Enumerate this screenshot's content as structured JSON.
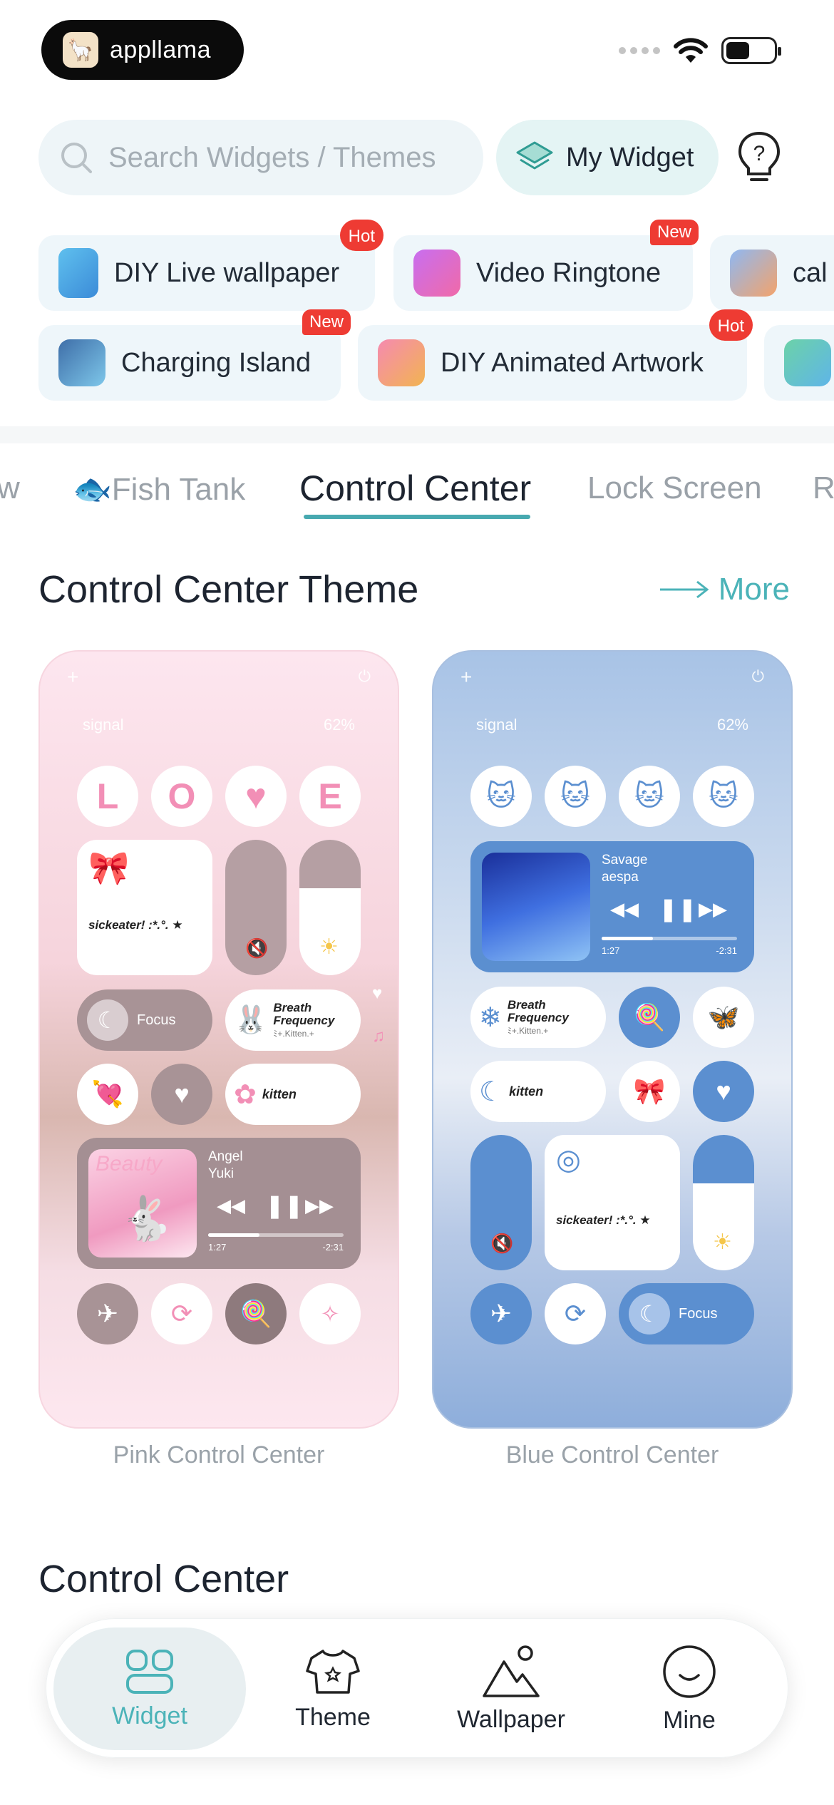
{
  "brand": {
    "name": "appllama",
    "logo_icon": "llama-logo-icon"
  },
  "status": {
    "wifi_icon": "wifi-icon",
    "battery_icon": "battery-icon"
  },
  "search": {
    "placeholder": "Search Widgets / Themes"
  },
  "my_widget": {
    "label": "My Widget"
  },
  "features": {
    "row1": [
      {
        "label": "DIY Live wallpaper",
        "badge": "Hot"
      },
      {
        "label": "Video Ringtone",
        "badge": "New"
      },
      {
        "label": "cal",
        "badge": ""
      }
    ],
    "row2": [
      {
        "label": "Charging Island",
        "badge": "New"
      },
      {
        "label": "DIY Animated Artwork",
        "badge": "Hot"
      }
    ]
  },
  "tabs": [
    "w",
    "🐟Fish Tank",
    "Control Center",
    "Lock Screen",
    "R"
  ],
  "active_tab": "Control Center",
  "section1": {
    "title": "Control Center Theme",
    "more": "More"
  },
  "cards": [
    {
      "caption": "Pink Control Center",
      "signal": "signal",
      "battery": "62%",
      "letters": [
        "L",
        "O",
        "E"
      ],
      "focus": "Focus",
      "breath": "Breath Frequency",
      "kitten_sub": "ﾐ+.Kitten.+",
      "kitten": "kitten",
      "quote": "sickeater! :*.°. ★",
      "music": {
        "title": "Angel",
        "artist": "Yuki",
        "elapsed": "1:27",
        "remaining": "-2:31",
        "art_text": "Beauty",
        "progress": 0.38
      }
    },
    {
      "caption": "Blue Control Center",
      "signal": "signal",
      "battery": "62%",
      "focus": "Focus",
      "breath": "Breath Frequency",
      "kitten_sub": "ﾐ+.Kitten.+",
      "kitten": "kitten",
      "quote": "sickeater! :*.°. ★",
      "music": {
        "title": "Savage",
        "artist": "aespa",
        "elapsed": "1:27",
        "remaining": "-2:31",
        "progress": 0.38
      }
    }
  ],
  "section2": {
    "title": "Control Center"
  },
  "nav": [
    {
      "label": "Widget",
      "icon": "widget-grid-icon",
      "active": true
    },
    {
      "label": "Theme",
      "icon": "shirt-icon",
      "active": false
    },
    {
      "label": "Wallpaper",
      "icon": "mountain-icon",
      "active": false
    },
    {
      "label": "Mine",
      "icon": "smile-icon",
      "active": false
    }
  ],
  "colors": {
    "accent": "#4bb3b8",
    "badge": "#ee3b33",
    "pink_tile": "#f58fb4",
    "blue_tile": "#5b8fd0"
  }
}
